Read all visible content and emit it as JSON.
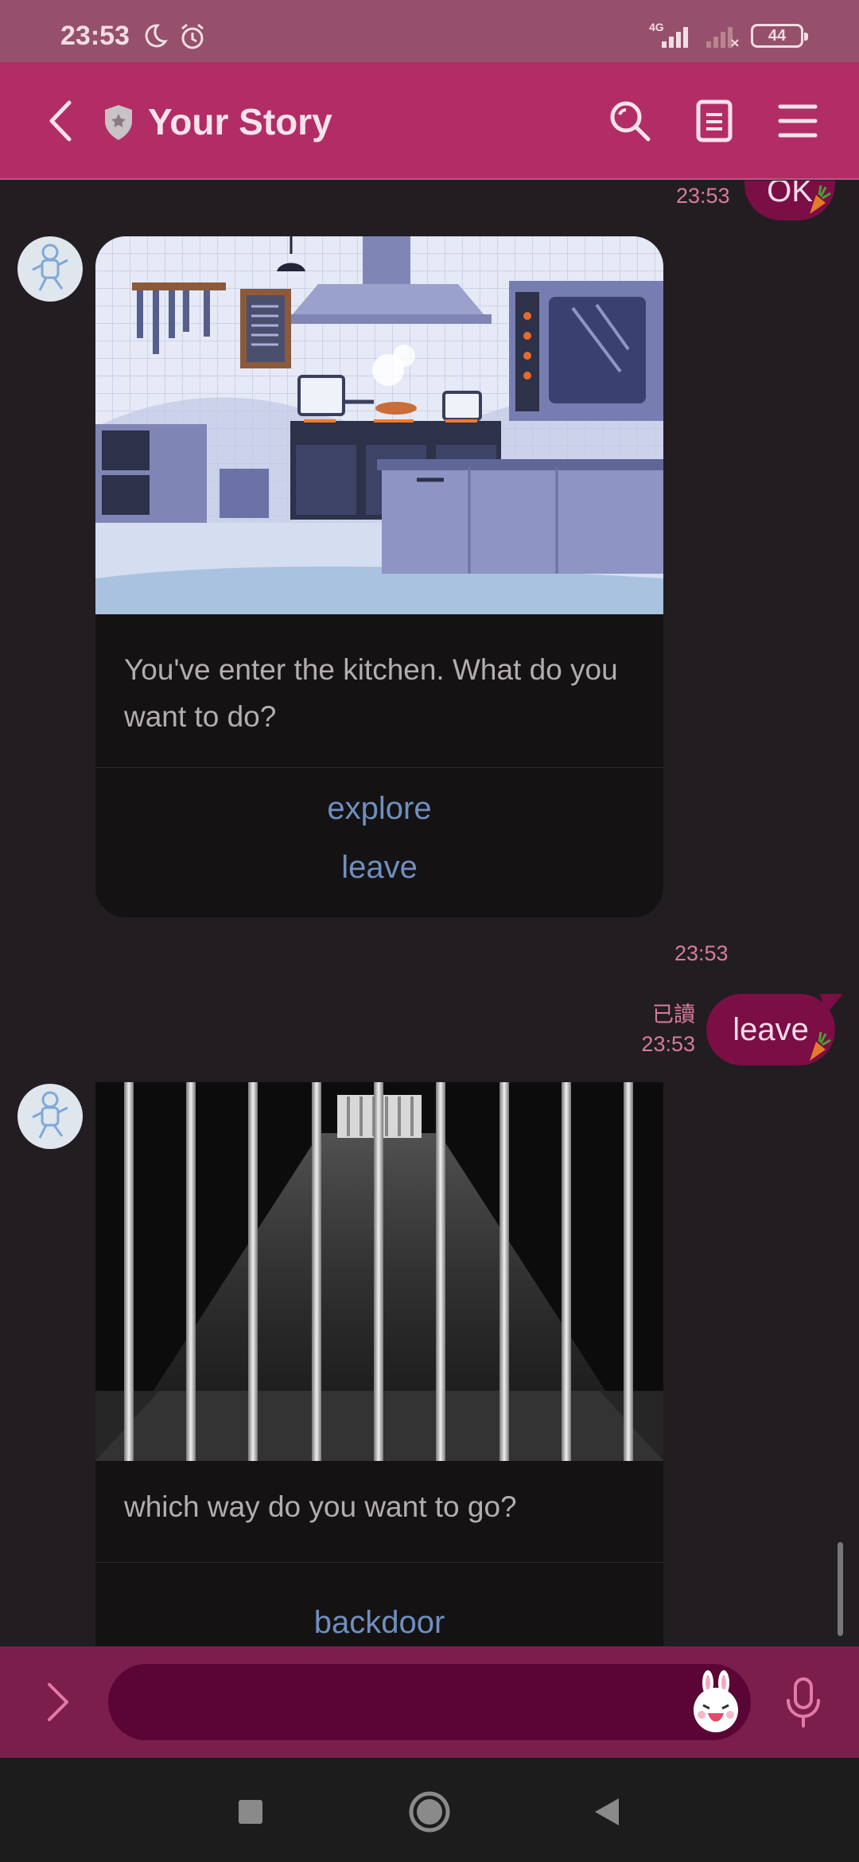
{
  "status_bar": {
    "time": "23:53",
    "network": "4G",
    "battery": "44"
  },
  "header": {
    "title": "Your Story"
  },
  "chat": {
    "top_message": {
      "text": "OK",
      "time": "23:53"
    },
    "card1": {
      "text": "You've enter the kitchen. What do you want to do?",
      "actions": [
        "explore",
        "leave"
      ],
      "time": "23:53"
    },
    "reply1": {
      "text": "leave",
      "read_label": "已讀",
      "time": "23:53"
    },
    "card2": {
      "text": "which way do you want to go?",
      "actions": [
        "backdoor"
      ]
    }
  },
  "input": {
    "placeholder": ""
  },
  "colors": {
    "header": "#b22d65",
    "status_bar": "#96506b",
    "bubble": "#7a0e45",
    "link": "#6f8fbf",
    "timestamp": "#d87aa0"
  },
  "icons": [
    "back-icon",
    "shield-icon",
    "search-icon",
    "notes-icon",
    "menu-icon",
    "chevron-right-icon",
    "sticker-icon",
    "mic-icon",
    "recent-apps-icon",
    "home-icon",
    "back-nav-icon"
  ]
}
